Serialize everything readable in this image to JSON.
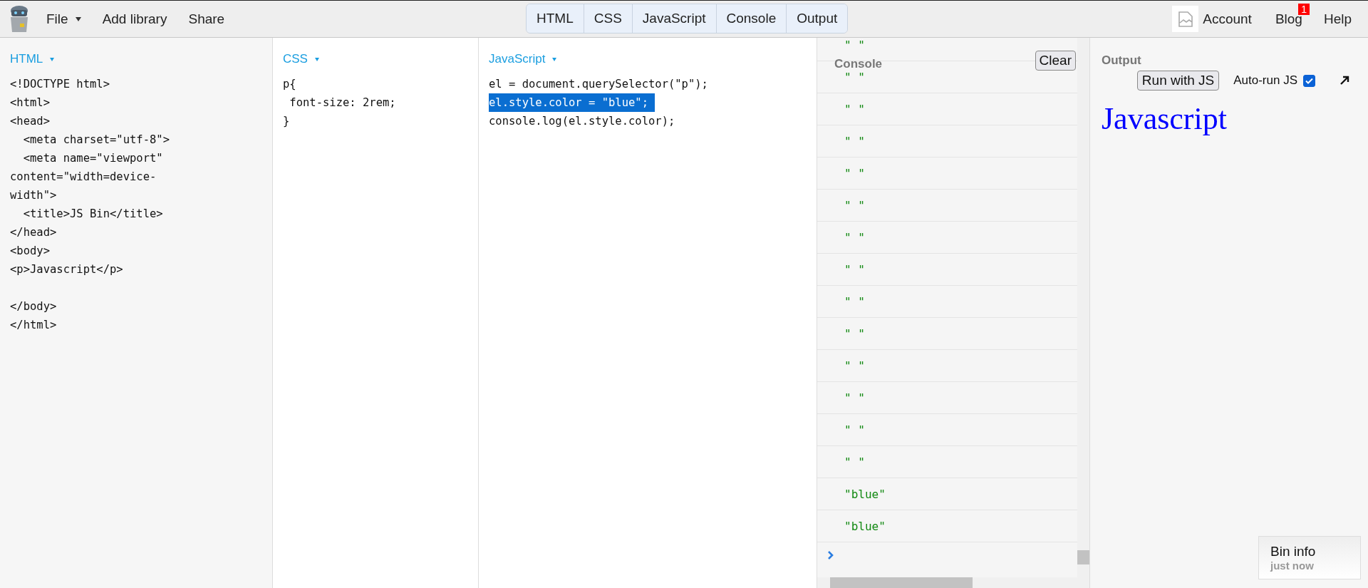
{
  "toolbar": {
    "menu": [
      {
        "label": "File",
        "dropdown": true
      },
      {
        "label": "Add library",
        "dropdown": false
      },
      {
        "label": "Share",
        "dropdown": false
      }
    ],
    "panel_tabs": [
      {
        "label": "HTML",
        "selected": true
      },
      {
        "label": "CSS",
        "selected": true
      },
      {
        "label": "JavaScript",
        "selected": true
      },
      {
        "label": "Console",
        "selected": true
      },
      {
        "label": "Output",
        "selected": true
      }
    ],
    "account": "Account",
    "blog": {
      "label": "Blog",
      "badge": "1"
    },
    "help": "Help"
  },
  "editors": [
    {
      "title": "HTML",
      "lines": [
        {
          "text": "<!DOCTYPE html>",
          "selected": false
        },
        {
          "text": "<html>",
          "selected": false
        },
        {
          "text": "<head>",
          "selected": false
        },
        {
          "text": "  <meta charset=\"utf-8\">",
          "selected": false
        },
        {
          "text": "  <meta name=\"viewport\"",
          "selected": false
        },
        {
          "text": "content=\"width=device-",
          "selected": false
        },
        {
          "text": "width\">",
          "selected": false
        },
        {
          "text": "  <title>JS Bin</title>",
          "selected": false
        },
        {
          "text": "</head>",
          "selected": false
        },
        {
          "text": "<body>",
          "selected": false
        },
        {
          "text": "<p>Javascript</p>",
          "selected": false
        },
        {
          "selected": false
        },
        {
          "text": "</body>",
          "selected": false
        },
        {
          "text": "</html>",
          "selected": false
        }
      ]
    },
    {
      "title": "CSS",
      "lines": [
        {
          "text": "p{",
          "selected": false
        },
        {
          "text": " font-size: 2rem;",
          "selected": false
        },
        {
          "text": "}",
          "selected": false
        }
      ]
    },
    {
      "title": "JavaScript",
      "lines": [
        {
          "text": "el = document.querySelector(\"p\");",
          "selected": false
        },
        {
          "text": "el.style.color = \"blue\"; ",
          "selected": true
        },
        {
          "text": "console.log(el.style.color);",
          "selected": false
        }
      ]
    }
  ],
  "console": {
    "title": "Console",
    "clear_button": "Clear",
    "entries": [
      "\" \"",
      "\" \"",
      "\" \"",
      "\" \"",
      "\" \"",
      "\" \"",
      "\" \"",
      "\" \"",
      "\" \"",
      "\" \"",
      "\" \"",
      "\" \"",
      "\" \"",
      "\" \"",
      "\"blue\"",
      "\"blue\""
    ]
  },
  "output": {
    "title": "Output",
    "run_button": "Run with JS",
    "autorun": {
      "label": "Auto-run JS",
      "checked": true
    },
    "content": "Javascript",
    "bin_info": {
      "title": "Bin info",
      "time": "just now"
    }
  }
}
